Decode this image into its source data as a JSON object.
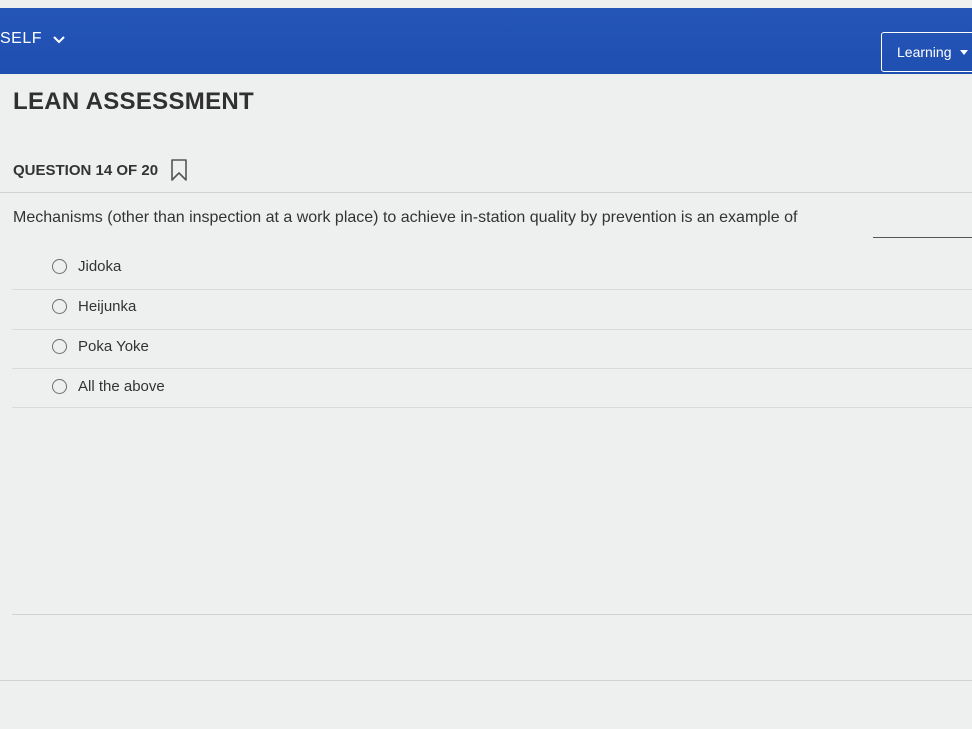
{
  "header": {
    "brand": "SELF",
    "learning_label": "Learning"
  },
  "assessment": {
    "title": "LEAN ASSESSMENT",
    "question_label": "QUESTION 14 OF 20",
    "question_text": "Mechanisms (other than inspection at a work place) to achieve in-station quality by prevention is an example of",
    "options": [
      {
        "label": "Jidoka"
      },
      {
        "label": "Heijunka"
      },
      {
        "label": "Poka Yoke"
      },
      {
        "label": "All the above"
      }
    ]
  },
  "colors": {
    "topbar": "#1f4fb0",
    "background": "#eef0ef"
  }
}
